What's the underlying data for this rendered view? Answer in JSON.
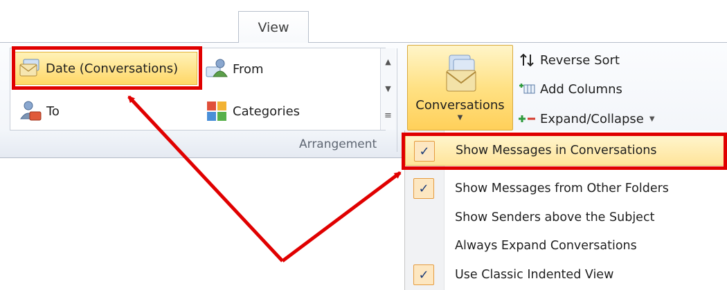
{
  "ribbon": {
    "tab_label": "View",
    "arrangement": {
      "group_label": "Arrangement",
      "items": [
        {
          "label": "Date (Conversations)",
          "icon": "envelope-conversations-icon",
          "selected": true
        },
        {
          "label": "From",
          "icon": "from-person-icon"
        },
        {
          "label": "To",
          "icon": "to-person-icon"
        },
        {
          "label": "Categories",
          "icon": "categories-grid-icon"
        }
      ]
    },
    "conversations": {
      "label": "Conversations",
      "icon": "stacked-envelopes-icon"
    },
    "sort_buttons": [
      {
        "label": "Reverse Sort",
        "icon": "reverse-sort-icon"
      },
      {
        "label": "Add Columns",
        "icon": "add-columns-icon"
      },
      {
        "label": "Expand/Collapse",
        "icon": "expand-collapse-icon"
      }
    ]
  },
  "menu": {
    "items": [
      {
        "label": "Show Messages in Conversations",
        "checked": true,
        "highlighted": true
      },
      {
        "label": "Show Messages from Other Folders",
        "checked": true
      },
      {
        "label": "Show Senders above the Subject",
        "checked": false
      },
      {
        "label": "Always Expand Conversations",
        "checked": false
      },
      {
        "label": "Use Classic Indented View",
        "checked": true
      }
    ]
  },
  "annotation": {
    "color": "#e00000"
  },
  "colors": {
    "highlight": "#ffd766",
    "check_border": "#e59b3e",
    "check_mark": "#1a3a78"
  }
}
